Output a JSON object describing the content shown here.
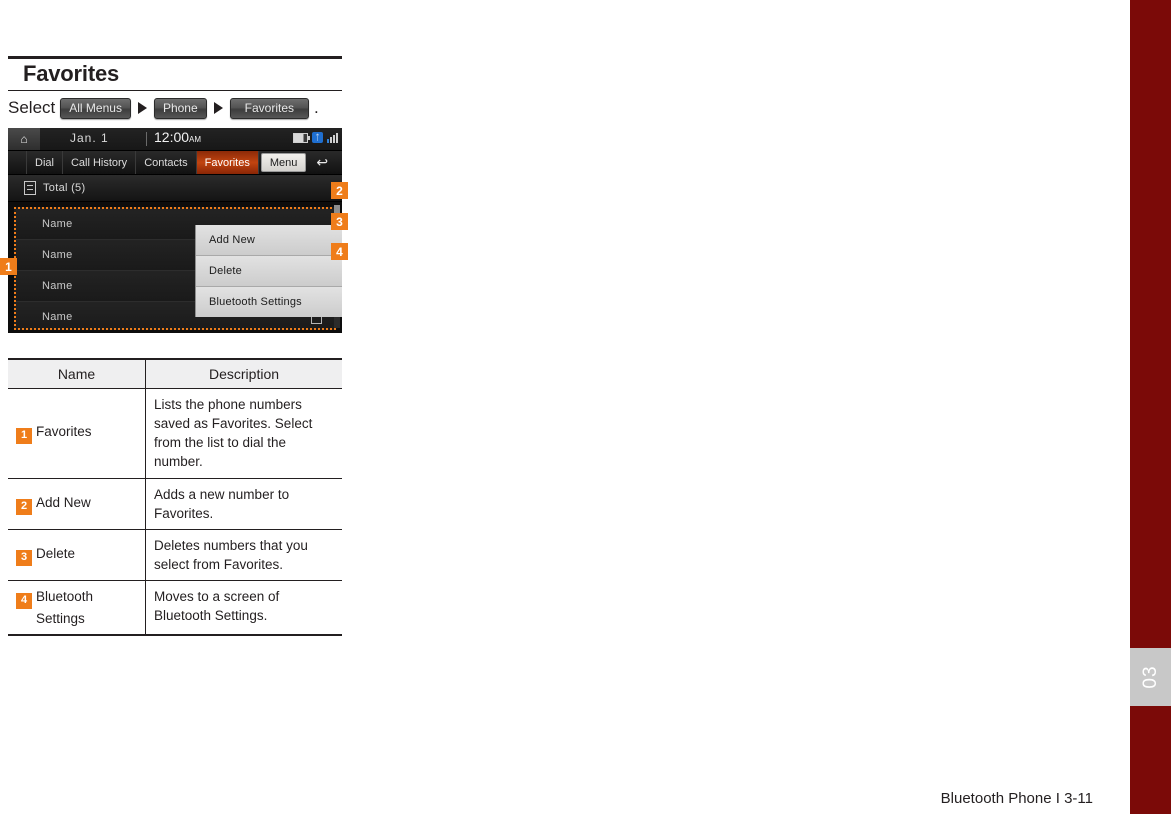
{
  "page": {
    "title": "Favorites",
    "select_word": "Select",
    "period": ".",
    "footer": "Bluetooth Phone I 3-11",
    "chapter_tab": "03",
    "accent_orange": "#ef7d1a",
    "edge_red": "#7b0a08"
  },
  "breadcrumb": [
    {
      "label": "All Menus"
    },
    {
      "label": "Phone"
    },
    {
      "label": "Favorites"
    }
  ],
  "device": {
    "status_bar": {
      "home_icon": "home-icon",
      "date": "Jan.  1",
      "time": "12:00",
      "ampm": "AM",
      "battery_icon": "battery-icon",
      "bluetooth_icon": "bluetooth-icon",
      "signal_icon": "signal-icon"
    },
    "tabs": [
      {
        "label": "Dial",
        "active": false
      },
      {
        "label": "Call History",
        "active": false
      },
      {
        "label": "Contacts",
        "active": false
      },
      {
        "label": "Favorites",
        "active": true
      }
    ],
    "menu_button": "Menu",
    "back_icon": "back-arrow-icon",
    "total_label": "Total (5)",
    "list_rows": [
      {
        "name": "Name",
        "star": false
      },
      {
        "name": "Name",
        "star": false
      },
      {
        "name": "Name",
        "star": true
      },
      {
        "name": "Name",
        "star": true
      }
    ],
    "dropdown": [
      {
        "label": "Add New"
      },
      {
        "label": "Delete"
      },
      {
        "label": "Bluetooth Settings"
      }
    ]
  },
  "callouts": {
    "one": "1",
    "two": "2",
    "three": "3",
    "four": "4"
  },
  "table": {
    "headers": {
      "name": "Name",
      "description": "Description"
    },
    "rows": [
      {
        "num": "1",
        "name": "Favorites",
        "name2": "",
        "description": "Lists the phone numbers saved as Favorites. Select from the list to dial the number."
      },
      {
        "num": "2",
        "name": "Add New",
        "name2": "",
        "description": "Adds a new number to Favorites."
      },
      {
        "num": "3",
        "name": "Delete",
        "name2": "",
        "description": "Deletes numbers that you select from Favorites."
      },
      {
        "num": "4",
        "name": "Bluetooth",
        "name2": "Settings",
        "description": "Moves to a screen of Bluetooth Settings."
      }
    ]
  }
}
